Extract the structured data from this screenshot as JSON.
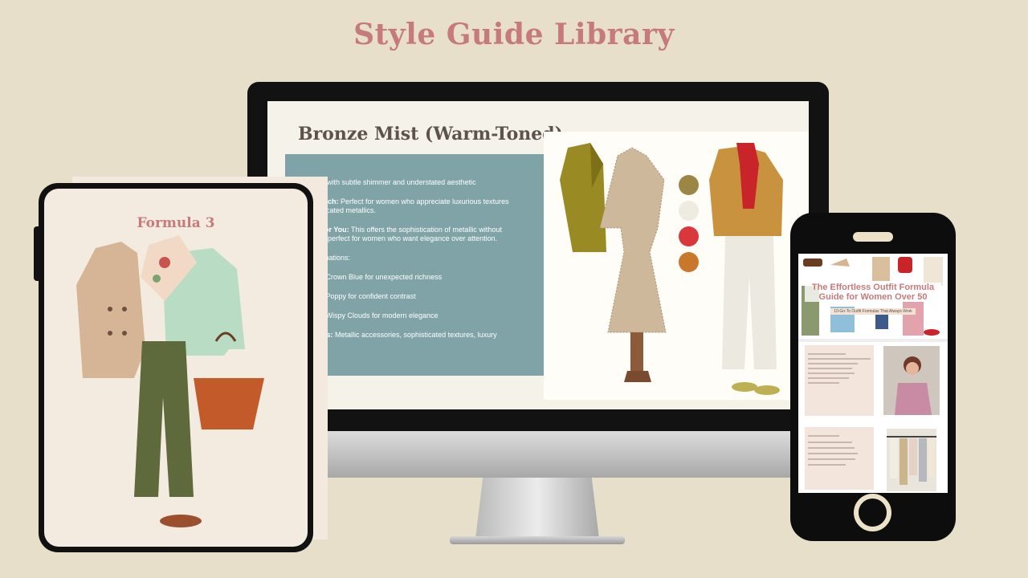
{
  "page": {
    "title": "Style Guide Library"
  },
  "colors": {
    "accent": "#c67a7b",
    "background": "#e8dfcb",
    "teal_panel": "#80a3a7"
  },
  "monitor": {
    "slide_title": "Bronze Mist (Warm-Toned)",
    "lines": [
      {
        "bold": "",
        "text": "rown with subtle shimmer and understated aesthetic"
      },
      {
        "bold": "y Match:",
        "text": " Perfect for women who appreciate luxurious textures",
        "cont": "phisticated metallics."
      },
      {
        "bold": "rks for You:",
        "text": " This offers the sophistication of metallic without",
        "cont": "shy—perfect for women who want elegance over attention."
      },
      {
        "bold": "",
        "text": "ombinations:"
      },
      {
        "bold": "",
        "text": "With Crown Blue for unexpected richness"
      },
      {
        "bold": "",
        "text": "With Poppy for confident contrast"
      },
      {
        "bold": "",
        "text": "With Wispy Clouds for modern elegance"
      },
      {
        "bold": "Focus:",
        "text": " Metallic accessories, sophisticated textures, luxury"
      }
    ],
    "swatches": [
      "#9b8646",
      "#eeebe1",
      "#d9373b",
      "#c9772a"
    ]
  },
  "tablet": {
    "title": "Formula 3"
  },
  "phone": {
    "promo_title": "The Effortless Outfit Formula Guide for Women Over 50",
    "promo_subtitle": "10-Go-To Outfit Formulas That Always Work"
  }
}
